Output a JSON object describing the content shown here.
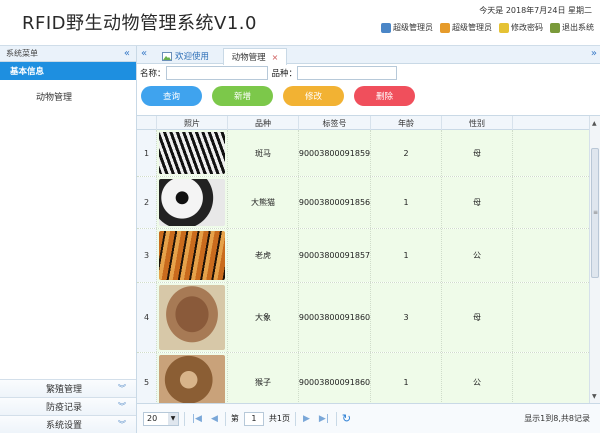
{
  "header": {
    "title": "RFID野生动物管理系统V1.0",
    "date_text": "今天是 2018年7月24日 星期二",
    "links": [
      {
        "label": "超级管理员",
        "icon": "user-icon"
      },
      {
        "label": "超级管理员",
        "icon": "user-group-icon"
      },
      {
        "label": "修改密码",
        "icon": "key-icon"
      },
      {
        "label": "退出系统",
        "icon": "exit-icon"
      }
    ]
  },
  "sidebar": {
    "title": "系统菜单",
    "collapse_icon": "«",
    "active_category": "基本信息",
    "items": [
      "动物管理"
    ],
    "sections": [
      "繁殖管理",
      "防疫记录",
      "系统设置"
    ]
  },
  "tabs": {
    "welcome": "欢迎使用",
    "active": "动物管理",
    "close": "×",
    "scroll_left": "«",
    "scroll_right": "»"
  },
  "search": {
    "name_label": "名称：",
    "breed_label": "品种："
  },
  "buttons": {
    "query": "查询",
    "add": "新增",
    "edit": "修改",
    "delete": "删除"
  },
  "table": {
    "headers": [
      "",
      "照片",
      "品种",
      "标签号",
      "年龄",
      "性别"
    ],
    "rows": [
      {
        "num": "1",
        "breed": "斑马",
        "tag": "90003800091859",
        "age": "2",
        "sex": "母",
        "photo": "zebra-photo"
      },
      {
        "num": "2",
        "breed": "大熊猫",
        "tag": "90003800091856",
        "age": "1",
        "sex": "母",
        "photo": "panda-photo"
      },
      {
        "num": "3",
        "breed": "老虎",
        "tag": "90003800091857",
        "age": "1",
        "sex": "公",
        "photo": "tiger-photo"
      },
      {
        "num": "4",
        "breed": "大象",
        "tag": "90003800091860",
        "age": "3",
        "sex": "母",
        "photo": "elephant-photo"
      },
      {
        "num": "5",
        "breed": "猴子",
        "tag": "90003800091860",
        "age": "1",
        "sex": "公",
        "photo": "monkey-photo"
      }
    ]
  },
  "pager": {
    "page_size": "20",
    "page_prefix": "第",
    "page_current": "1",
    "page_total": "共1页",
    "info": "显示1到8,共8记录"
  },
  "colors": {
    "accent": "#1e8fe0",
    "query": "#3fa3ee",
    "add": "#7cc84a",
    "edit": "#f2b233",
    "delete": "#f04f5c"
  }
}
